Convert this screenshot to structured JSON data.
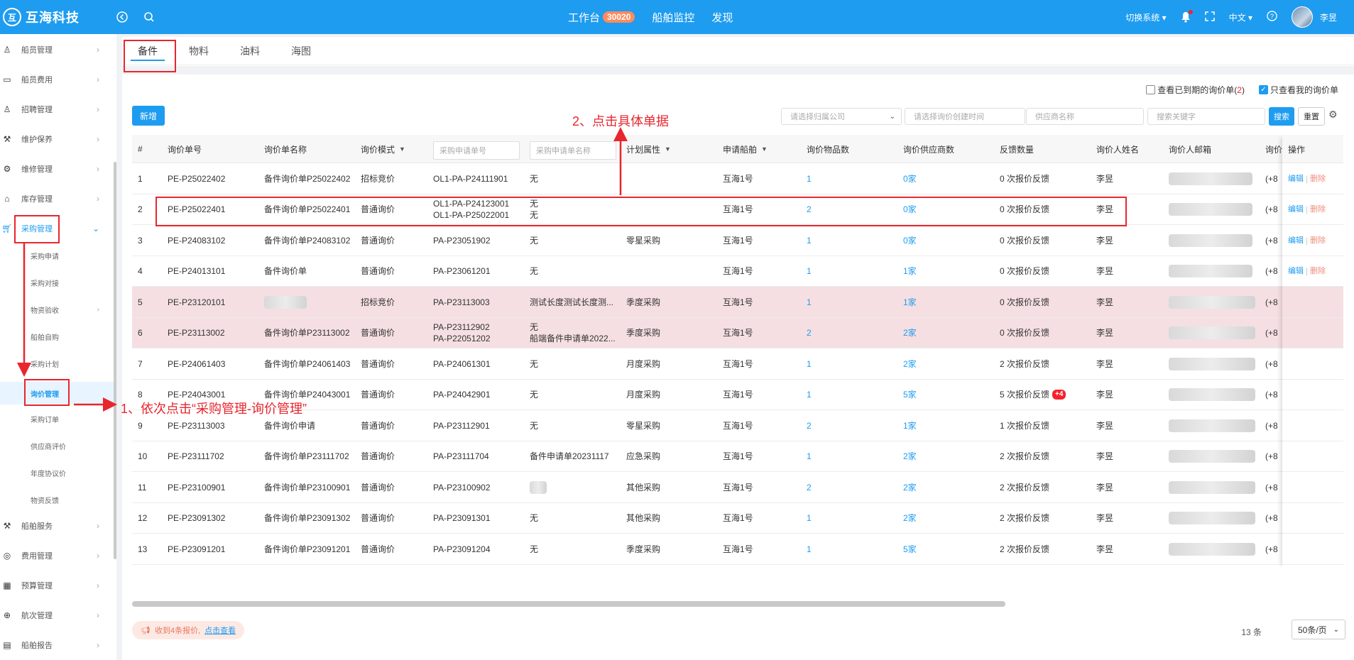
{
  "header": {
    "logo_text": "互海科技",
    "logo_mark": "互",
    "nav": [
      {
        "label": "工作台",
        "badge": "30020"
      },
      {
        "label": "船舶监控"
      },
      {
        "label": "发现"
      }
    ],
    "switch_system": "切换系统",
    "language": "中文",
    "user_name": "李昱"
  },
  "sidebar": {
    "items": [
      {
        "label": "船员管理",
        "icon": "person-icon"
      },
      {
        "label": "船员费用",
        "icon": "wallet-icon"
      },
      {
        "label": "招聘管理",
        "icon": "recruit-icon"
      },
      {
        "label": "维护保养",
        "icon": "maintenance-icon"
      },
      {
        "label": "维修管理",
        "icon": "wrench-icon"
      },
      {
        "label": "库存管理",
        "icon": "warehouse-icon"
      },
      {
        "label": "采购管理",
        "icon": "cart-icon"
      },
      {
        "label": "船舶服务",
        "icon": "service-icon"
      },
      {
        "label": "费用管理",
        "icon": "coins-icon"
      },
      {
        "label": "预算管理",
        "icon": "budget-icon"
      },
      {
        "label": "航次管理",
        "icon": "voyage-icon"
      },
      {
        "label": "船舶报告",
        "icon": "report-icon"
      }
    ],
    "sub_items": [
      "采购申请",
      "采购对接",
      "物资验收",
      "船舶自购",
      "采购计划",
      "询价管理",
      "采购订单",
      "供应商评价",
      "年度协议价",
      "物资反馈"
    ]
  },
  "tabs": [
    "备件",
    "物料",
    "油料",
    "海图"
  ],
  "checks": {
    "expired_label": "查看已到期的询价单(",
    "expired_count": "2",
    "expired_close": ")",
    "mine_label": "只查看我的询价单"
  },
  "toolbar": {
    "add_label": "新增",
    "company_placeholder": "请选择归属公司",
    "created_time_placeholder": "请选择询价创建时间",
    "supplier_placeholder": "供应商名称",
    "keyword_placeholder": "搜索关键字",
    "search_label": "搜索",
    "reset_label": "重置"
  },
  "table": {
    "headers": [
      "#",
      "询价单号",
      "询价单名称",
      "询价模式",
      "采购申请单号",
      "采购申请单名称",
      "计划属性",
      "申请船舶",
      "询价物品数",
      "询价供应商数",
      "反馈数量",
      "询价人姓名",
      "询价人邮箱",
      "询价",
      "操作"
    ],
    "rows": [
      {
        "no": "1",
        "code": "PE-P25022402",
        "name": "备件询价单P25022402",
        "mode": "招标竞价",
        "req_no": [
          "OL1-PA-P24111901"
        ],
        "req_name": [
          "无"
        ],
        "plan": "",
        "ship": "互海1号",
        "items": "1",
        "suppliers": "0家",
        "feedback": "0 次报价反馈",
        "fb_badge": "",
        "person": "李昱",
        "phone": "(+8",
        "ops": true,
        "pink": false
      },
      {
        "no": "2",
        "code": "PE-P25022401",
        "name": "备件询价单P25022401",
        "mode": "普通询价",
        "req_no": [
          "OL1-PA-P24123001",
          "OL1-PA-P25022001"
        ],
        "req_name": [
          "无",
          "无"
        ],
        "plan": "",
        "ship": "互海1号",
        "items": "2",
        "suppliers": "0家",
        "feedback": "0 次报价反馈",
        "fb_badge": "",
        "person": "李昱",
        "phone": "(+8",
        "ops": true,
        "pink": false
      },
      {
        "no": "3",
        "code": "PE-P24083102",
        "name": "备件询价单P24083102",
        "mode": "普通询价",
        "req_no": [
          "PA-P23051902"
        ],
        "req_name": [
          "无"
        ],
        "plan": "零星采购",
        "ship": "互海1号",
        "items": "1",
        "suppliers": "0家",
        "feedback": "0 次报价反馈",
        "fb_badge": "",
        "person": "李昱",
        "phone": "(+8",
        "ops": true,
        "pink": false
      },
      {
        "no": "4",
        "code": "PE-P24013101",
        "name": "备件询价单",
        "mode": "普通询价",
        "req_no": [
          "PA-P23061201"
        ],
        "req_name": [
          "无"
        ],
        "plan": "",
        "ship": "互海1号",
        "items": "1",
        "suppliers": "1家",
        "feedback": "0 次报价反馈",
        "fb_badge": "",
        "person": "李昱",
        "phone": "(+8",
        "ops": true,
        "pink": false
      },
      {
        "no": "5",
        "code": "PE-P23120101",
        "name": "",
        "mode": "招标竞价",
        "req_no": [
          "PA-P23113003"
        ],
        "req_name": [
          "测试长度测试长度测..."
        ],
        "plan": "季度采购",
        "ship": "互海1号",
        "items": "1",
        "suppliers": "1家",
        "feedback": "0 次报价反馈",
        "fb_badge": "",
        "person": "李昱",
        "phone": "(+8",
        "ops": false,
        "pink": true
      },
      {
        "no": "6",
        "code": "PE-P23113002",
        "name": "备件询价单P23113002",
        "mode": "普通询价",
        "req_no": [
          "PA-P23112902",
          "PA-P22051202"
        ],
        "req_name": [
          "无",
          "船端备件申请单2022..."
        ],
        "plan": "季度采购",
        "ship": "互海1号",
        "items": "2",
        "suppliers": "2家",
        "feedback": "0 次报价反馈",
        "fb_badge": "",
        "person": "李昱",
        "phone": "(+8",
        "ops": false,
        "pink": true
      },
      {
        "no": "7",
        "code": "PE-P24061403",
        "name": "备件询价单P24061403",
        "mode": "普通询价",
        "req_no": [
          "PA-P24061301"
        ],
        "req_name": [
          "无"
        ],
        "plan": "月度采购",
        "ship": "互海1号",
        "items": "1",
        "suppliers": "2家",
        "feedback": "2 次报价反馈",
        "fb_badge": "",
        "person": "李昱",
        "phone": "(+8",
        "ops": false,
        "pink": false
      },
      {
        "no": "8",
        "code": "PE-P24043001",
        "name": "备件询价单P24043001",
        "mode": "普通询价",
        "req_no": [
          "PA-P24042901"
        ],
        "req_name": [
          "无"
        ],
        "plan": "月度采购",
        "ship": "互海1号",
        "items": "1",
        "suppliers": "5家",
        "feedback": "5 次报价反馈",
        "fb_badge": "+4",
        "person": "李昱",
        "phone": "(+8",
        "ops": false,
        "pink": false
      },
      {
        "no": "9",
        "code": "PE-P23113003",
        "name": "备件询价申请",
        "mode": "普通询价",
        "req_no": [
          "PA-P23112901"
        ],
        "req_name": [
          "无"
        ],
        "plan": "零星采购",
        "ship": "互海1号",
        "items": "2",
        "suppliers": "1家",
        "feedback": "1 次报价反馈",
        "fb_badge": "",
        "person": "李昱",
        "phone": "(+8",
        "ops": false,
        "pink": false
      },
      {
        "no": "10",
        "code": "PE-P23111702",
        "name": "备件询价单P23111702",
        "mode": "普通询价",
        "req_no": [
          "PA-P23111704"
        ],
        "req_name": [
          "备件申请单20231117"
        ],
        "plan": "应急采购",
        "ship": "互海1号",
        "items": "1",
        "suppliers": "2家",
        "feedback": "2 次报价反馈",
        "fb_badge": "",
        "person": "李昱",
        "phone": "(+8",
        "ops": false,
        "pink": false
      },
      {
        "no": "11",
        "code": "PE-P23100901",
        "name": "备件询价单P23100901",
        "mode": "普通询价",
        "req_no": [
          "PA-P23100902"
        ],
        "req_name": [
          ""
        ],
        "plan": "其他采购",
        "ship": "互海1号",
        "items": "2",
        "suppliers": "2家",
        "feedback": "2 次报价反馈",
        "fb_badge": "",
        "person": "李昱",
        "phone": "(+8",
        "ops": false,
        "pink": false
      },
      {
        "no": "12",
        "code": "PE-P23091302",
        "name": "备件询价单P23091302",
        "mode": "普通询价",
        "req_no": [
          "PA-P23091301"
        ],
        "req_name": [
          "无"
        ],
        "plan": "其他采购",
        "ship": "互海1号",
        "items": "1",
        "suppliers": "2家",
        "feedback": "2 次报价反馈",
        "fb_badge": "",
        "person": "李昱",
        "phone": "(+8",
        "ops": false,
        "pink": false
      },
      {
        "no": "13",
        "code": "PE-P23091201",
        "name": "备件询价单P23091201",
        "mode": "普通询价",
        "req_no": [
          "PA-P23091204"
        ],
        "req_name": [
          "无"
        ],
        "plan": "季度采购",
        "ship": "互海1号",
        "items": "1",
        "suppliers": "5家",
        "feedback": "2 次报价反馈",
        "fb_badge": "",
        "person": "李昱",
        "phone": "(+8",
        "ops": false,
        "pink": false
      }
    ],
    "edit_label": "编辑",
    "delete_label": "删除"
  },
  "footer": {
    "notice_text": "收到4条报价,",
    "notice_link": "点击查看",
    "total": "13 条",
    "page_size": "50条/页"
  },
  "annotations": {
    "step1": "1、依次点击“采购管理-询价管理”",
    "step2": "2、点击具体单据",
    "color": "#e8262e"
  }
}
